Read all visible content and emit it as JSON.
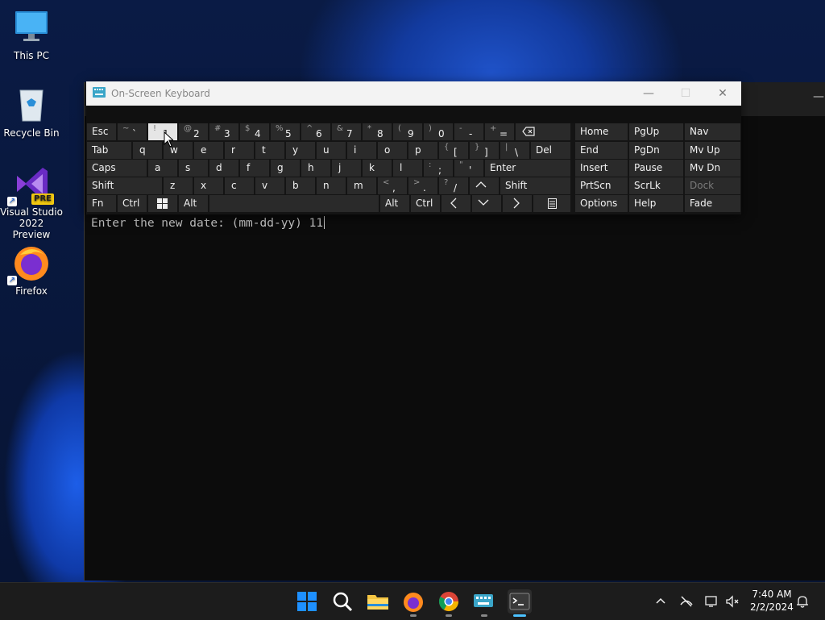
{
  "desktop": {
    "icons": [
      {
        "label": "This PC"
      },
      {
        "label": "Recycle Bin"
      },
      {
        "label_line1": "Visual Studio",
        "label_line2": "2022 Preview",
        "badge": "PRE"
      },
      {
        "label": "Firefox"
      }
    ]
  },
  "console": {
    "prompt": "Enter the new date: (mm-dd-yy) 11"
  },
  "osk": {
    "title": "On-Screen Keyboard",
    "window_buttons": {
      "minimize": "—",
      "maximize": "☐",
      "close": "✕"
    },
    "row1": {
      "esc": "Esc",
      "keys": [
        {
          "shift": "~",
          "main": "`"
        },
        {
          "shift": "!",
          "main": "1"
        },
        {
          "shift": "@",
          "main": "2"
        },
        {
          "shift": "#",
          "main": "3"
        },
        {
          "shift": "$",
          "main": "4"
        },
        {
          "shift": "%",
          "main": "5"
        },
        {
          "shift": "^",
          "main": "6"
        },
        {
          "shift": "&",
          "main": "7"
        },
        {
          "shift": "*",
          "main": "8"
        },
        {
          "shift": "(",
          "main": "9"
        },
        {
          "shift": ")",
          "main": "0"
        },
        {
          "shift": "-",
          "main": "-"
        },
        {
          "shift": "+",
          "main": "="
        }
      ],
      "backspace_icon": "backspace-icon"
    },
    "row2": {
      "tab": "Tab",
      "letters": [
        "q",
        "w",
        "e",
        "r",
        "t",
        "y",
        "u",
        "i",
        "o",
        "p"
      ],
      "brackets": [
        {
          "shift": "{",
          "main": "["
        },
        {
          "shift": "}",
          "main": "]"
        },
        {
          "shift": "|",
          "main": "\\"
        }
      ],
      "del": "Del"
    },
    "row3": {
      "caps": "Caps",
      "letters": [
        "a",
        "s",
        "d",
        "f",
        "g",
        "h",
        "j",
        "k",
        "l"
      ],
      "punct": [
        {
          "shift": ":",
          "main": ";"
        },
        {
          "shift": "\"",
          "main": "'"
        }
      ],
      "enter": "Enter"
    },
    "row4": {
      "shift_left": "Shift",
      "letters": [
        "z",
        "x",
        "c",
        "v",
        "b",
        "n",
        "m"
      ],
      "punct": [
        {
          "shift": "<",
          "main": ","
        },
        {
          "shift": ">",
          "main": "."
        },
        {
          "shift": "?",
          "main": "/"
        }
      ],
      "shift_right": "Shift"
    },
    "row5": {
      "fn": "Fn",
      "ctrl": "Ctrl",
      "alt": "Alt",
      "alt_r": "Alt",
      "ctrl_r": "Ctrl"
    },
    "nav_block": {
      "home": "Home",
      "pgup": "PgUp",
      "nav": "Nav",
      "end": "End",
      "pgdn": "PgDn",
      "mvup": "Mv Up",
      "insert": "Insert",
      "pause": "Pause",
      "mvdn": "Mv Dn",
      "prtscn": "PrtScn",
      "scrlk": "ScrLk",
      "dock": "Dock",
      "options": "Options",
      "help": "Help",
      "fade": "Fade"
    }
  },
  "taskbar": {
    "apps": [
      "windows-start",
      "search",
      "file-explorer",
      "firefox",
      "chrome",
      "on-screen-keyboard",
      "terminal"
    ],
    "clock": {
      "time": "7:40 AM",
      "date": "2/2/2024"
    }
  },
  "colors": {
    "accent": "#4cc2ff",
    "console_bg": "#0c0c0c",
    "key_bg": "#2a2a2a",
    "pressed_key": "#e6e6e6"
  }
}
